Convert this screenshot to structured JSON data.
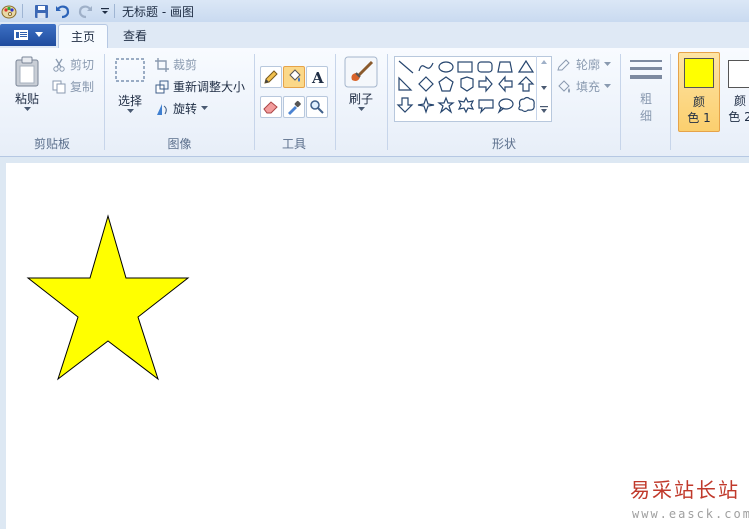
{
  "window": {
    "title": "无标题 - 画图"
  },
  "tabs": [
    {
      "label": "主页"
    },
    {
      "label": "查看"
    }
  ],
  "clipboard": {
    "paste_label": "粘贴",
    "cut_label": "剪切",
    "copy_label": "复制",
    "group_label": "剪贴板"
  },
  "image": {
    "select_label": "选择",
    "crop_label": "裁剪",
    "resize_label": "重新调整大小",
    "rotate_label": "旋转",
    "group_label": "图像"
  },
  "tools": {
    "group_label": "工具"
  },
  "brush": {
    "label": "刷子"
  },
  "shapes": {
    "group_label": "形状",
    "outline_label": "轮廓",
    "fill_label": "填充"
  },
  "size": {
    "label_1": "粗",
    "label_2": "细"
  },
  "colors": {
    "color1_label_1": "颜",
    "color1_label_2": "色 1",
    "color2_label_1": "颜",
    "color2_label_2": "色 2",
    "color1": "#ffff00",
    "color2": "#ffffff"
  },
  "canvas": {
    "star_fill": "#ffff00",
    "star_stroke": "#000000"
  },
  "watermark": {
    "line1": "易采站长站",
    "line2": "www.easck.com"
  }
}
